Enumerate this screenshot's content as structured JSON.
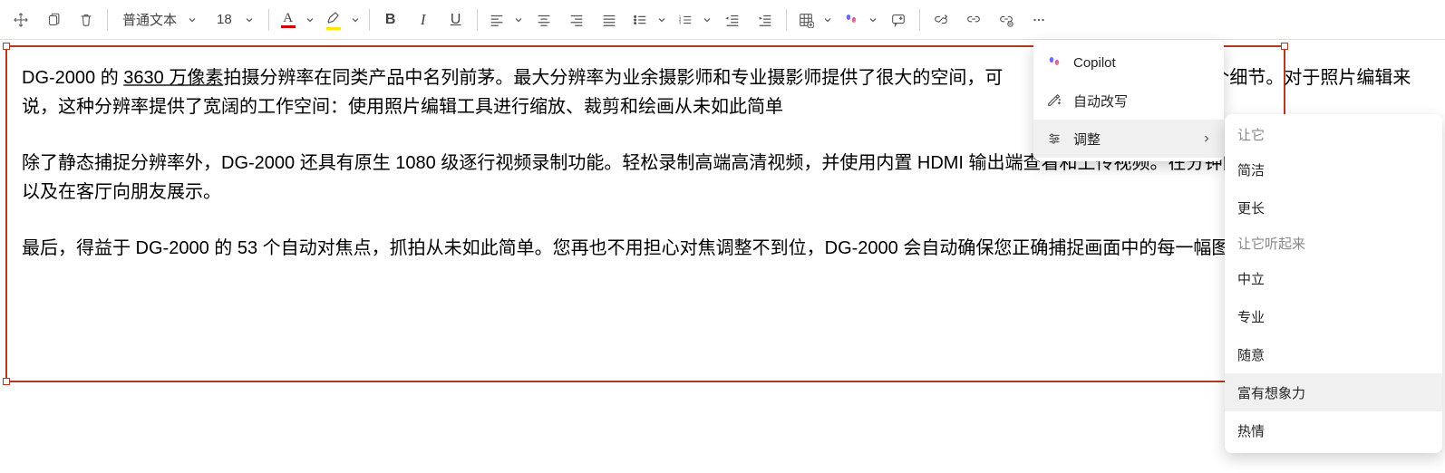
{
  "toolbar": {
    "style_label": "普通文本",
    "font_size": "18",
    "bold": "B",
    "italic": "I",
    "underline": "U"
  },
  "document": {
    "p1_a": "DG-2000 的 ",
    "p1_b": "3630 万像素",
    "p1_c": "拍摄分辨率在同类产品中名列前茅。最大分辨率为业余摄影师和专业摄影师提供了很大的空间，可",
    "p1_d": "中的每一个细节。对于照片编辑来说，这种分辨率提供了宽阔的工作空间：使用照片编辑工具进行缩放、裁剪和绘画从未如此简单",
    "p2": "除了静态捕捉分辨率外，DG-2000 还具有原生 1080 级逐行视频录制功能。轻松录制高端高清视频，并使用内置 HDMI 输出端查看和上传视频。在分钟内完成拍摄、相机预览以及在客厅向朋友展示。",
    "p3": "最后，得益于 DG-2000 的 53 个自动对焦点，抓拍从未如此简单。您再也不用担心对焦调整不到位，DG-2000 会自动确保您正确捕捉画面中的每一幅图像。"
  },
  "menu1": {
    "copilot": "Copilot",
    "auto_rewrite": "自动改写",
    "adjust": "调整"
  },
  "menu2": {
    "make_it": "让它",
    "concise": "简洁",
    "longer": "更长",
    "sound_like": "让它听起来",
    "neutral": "中立",
    "professional": "专业",
    "casual": "随意",
    "imaginative": "富有想象力",
    "enthusiastic": "热情"
  }
}
